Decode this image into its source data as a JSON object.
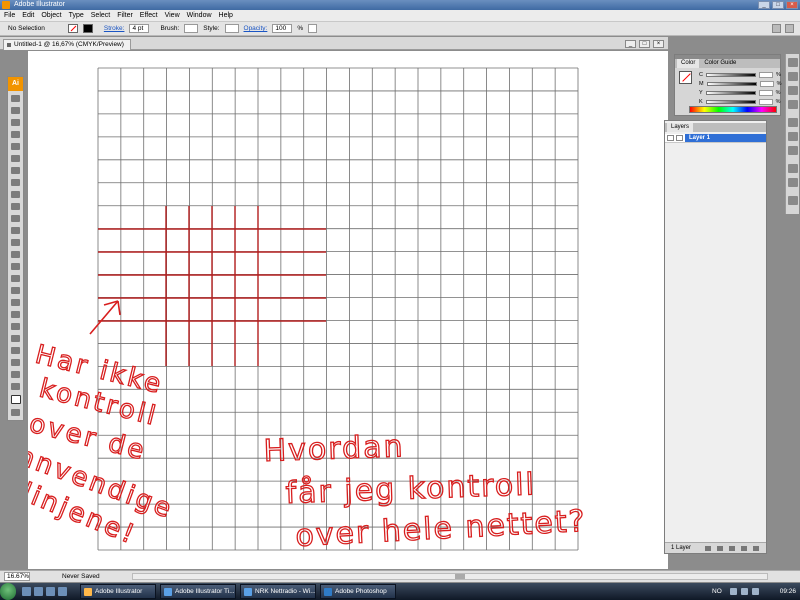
{
  "window": {
    "title": "Adobe Illustrator"
  },
  "menu": [
    "File",
    "Edit",
    "Object",
    "Type",
    "Select",
    "Filter",
    "Effect",
    "View",
    "Window",
    "Help"
  ],
  "control": {
    "selection": "No Selection",
    "stroke_label": "Stroke:",
    "stroke_value": "4 pt",
    "brush_label": "Brush:",
    "style_label": "Style:",
    "opacity_label": "Opacity:",
    "opacity_value": "100",
    "opacity_unit": "%"
  },
  "document": {
    "tab_title": "Untitled-1 @ 16,67% (CMYK/Preview)"
  },
  "tools": {
    "logo": "Ai"
  },
  "color_panel": {
    "tabs": [
      "Color",
      "Color Guide"
    ],
    "channels": [
      {
        "label": "C",
        "unit": "%"
      },
      {
        "label": "M",
        "unit": "%"
      },
      {
        "label": "Y",
        "unit": "%"
      },
      {
        "label": "K",
        "unit": "%"
      }
    ]
  },
  "layers_panel": {
    "tab": "Layers",
    "layer_name": "Layer 1",
    "footer": "1 Layer"
  },
  "status": {
    "zoom": "16.67%",
    "saved": "Never Saved"
  },
  "annotations": {
    "left": [
      "Har ikke",
      "kontroll",
      "over de",
      "innvendige",
      "linjene!"
    ],
    "right": [
      "Hvordan",
      "får jeg kontroll",
      "over hele nettet?"
    ],
    "ink_color": "#d81e1e",
    "grid_color": "#6e6e6e",
    "inner_grid_color": "#b31e1e"
  },
  "taskbar": {
    "items": [
      "Adobe Illustrator",
      "Adobe Illustrator Ti...",
      "NRK Nettradio - Wi...",
      "Adobe Photoshop"
    ],
    "lang": "NO",
    "clock": "09:26"
  }
}
